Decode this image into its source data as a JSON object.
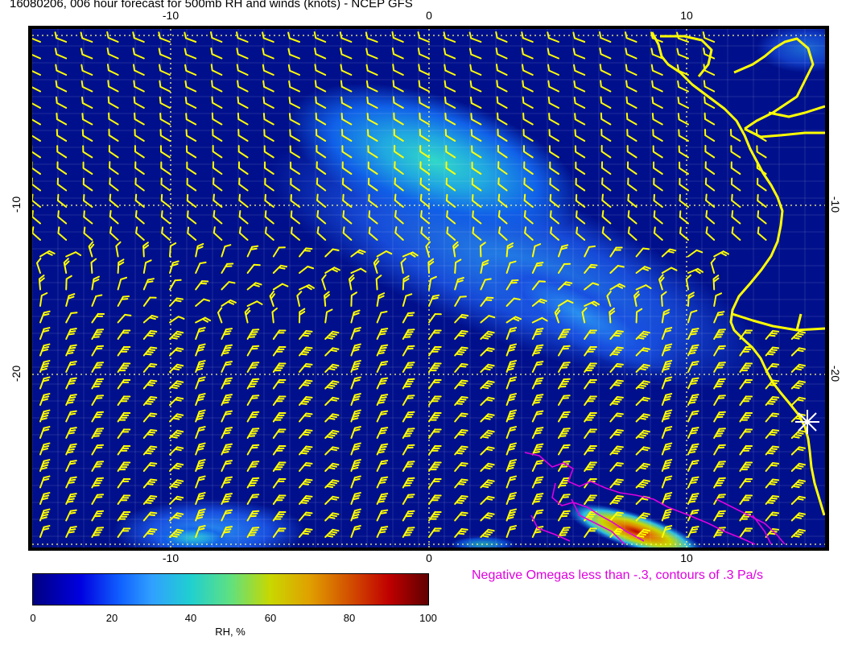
{
  "title": "16080206, 006 hour forecast for 500mb RH and winds (knots) - NCEP GFS",
  "map": {
    "lon_range": [
      -15.5,
      15.5
    ],
    "lat_range": [
      -30,
      2
    ],
    "lon_ticks": [
      "-10",
      "0",
      "10"
    ],
    "lat_ticks": [
      "-10",
      "-20"
    ],
    "background_color": "#00108c",
    "barb_color": "#ffff00",
    "coast_color": "#ffff00",
    "omega_color": "#e000e0",
    "marker": "white-star"
  },
  "colorbar": {
    "labels": [
      "0",
      "20",
      "40",
      "60",
      "80",
      "100"
    ],
    "title": "RH, %"
  },
  "note": "Negative Omegas less than -.3, contours of .3 Pa/s"
}
